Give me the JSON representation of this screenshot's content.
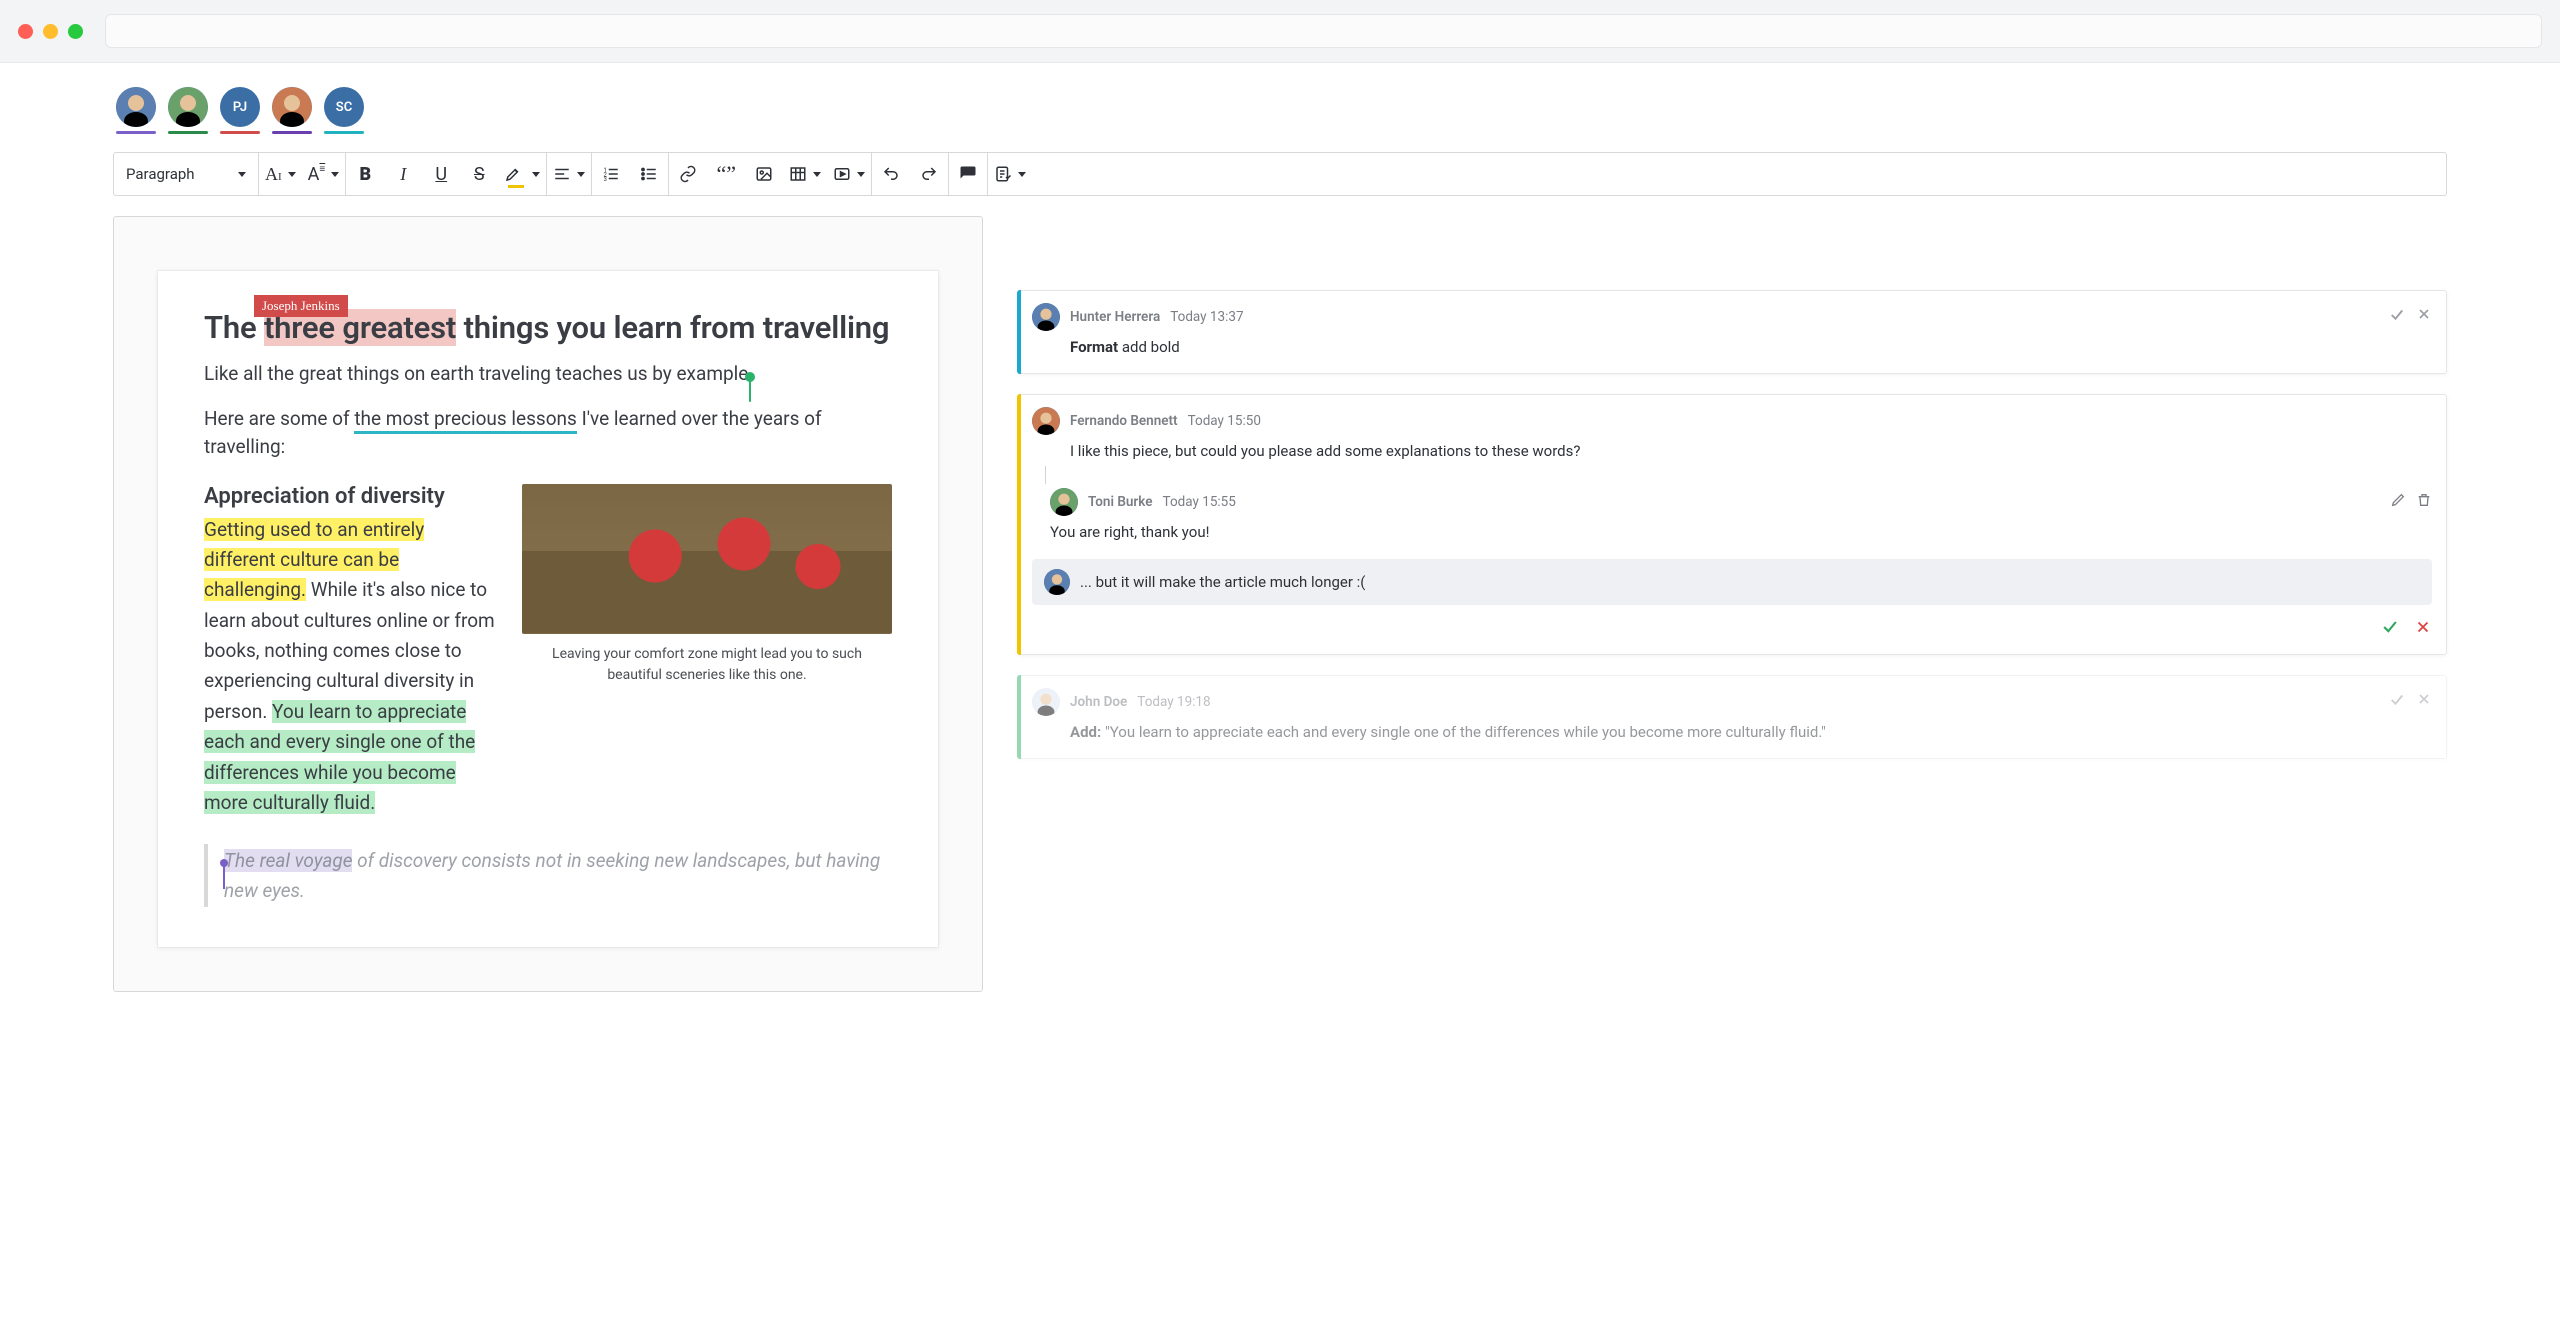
{
  "collaborators": [
    {
      "label": "",
      "underline": "#7a5fc9",
      "bg": "photo1"
    },
    {
      "label": "",
      "underline": "#2a8a4a",
      "bg": "photo2"
    },
    {
      "label": "PJ",
      "underline": "#d24b4b",
      "bg": "solid"
    },
    {
      "label": "",
      "underline": "#6b3fb0",
      "bg": "photo3"
    },
    {
      "label": "SC",
      "underline": "#21b2bd",
      "bg": "solid"
    }
  ],
  "toolbar": {
    "block_style": "Paragraph"
  },
  "cursor_label": "Joseph Jenkins",
  "document": {
    "title_pre": "The ",
    "title_sel": "three greatest",
    "title_post": " things you learn from travelling",
    "p1_pre": "Like all the great things on earth traveling teaches us by example",
    "p1_post": ".",
    "p2_pre": "Here are some of ",
    "p2_underlined": "the most precious lessons",
    "p2_post": " I've learned over the years of travelling:",
    "h2": "Appreciation of diversity",
    "body_hl_yellow": "Getting used to an entirely different culture can be challenging.",
    "body_plain_1": " While it's also nice to learn about cultures online or from books, nothing comes close to experiencing cultural diversity in person. ",
    "body_hl_green": "You learn to appreciate each and every single one of the differences while you become more culturally fluid.",
    "figcaption": "Leaving your comfort zone might lead you to such beautiful sceneries like this one.",
    "quote_sel": "The real voyage",
    "quote_rest": " of discovery consists not in seeking new landscapes, but having new eyes."
  },
  "comments": {
    "c1": {
      "stripe": "#1aa7d0",
      "author": "Hunter Herrera",
      "time": "Today 13:37",
      "action_label": "Format",
      "action_text": "add bold"
    },
    "thread": {
      "stripe": "#f0c400",
      "items": [
        {
          "author": "Fernando Bennett",
          "time": "Today 15:50",
          "text": "I like this piece, but could you please add some explanations to these words?",
          "actions": "none"
        },
        {
          "author": "Toni Burke",
          "time": "Today 15:55",
          "text": "You are right, thank you!",
          "actions": "edit-delete"
        }
      ],
      "reply_draft": "... but it will make the article much longer :("
    },
    "c_resolved": {
      "stripe": "#2fb36b",
      "author": "John Doe",
      "time": "Today 19:18",
      "action_label": "Add:",
      "action_text": "\"You learn to appreciate each and every single one of the differences while you become more culturally fluid.\""
    }
  }
}
